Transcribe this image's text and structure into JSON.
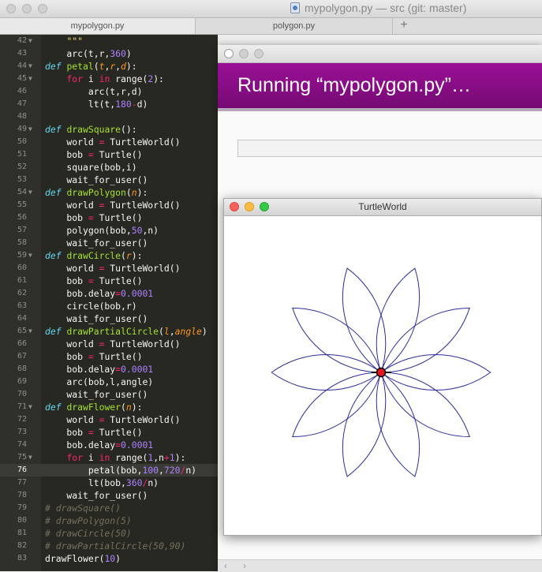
{
  "app": {
    "window_title": "mypolygon.py — src (git: master)"
  },
  "tabs": [
    {
      "label": "mypolygon.py",
      "active": true
    },
    {
      "label": "polygon.py",
      "active": false
    }
  ],
  "tab_add_label": "+",
  "editor": {
    "current_line": 76,
    "lines": [
      {
        "n": "42",
        "fold": true,
        "html": "    <span class=\"str\">\"\"\"</span>"
      },
      {
        "n": "43",
        "fold": false,
        "html": "    arc(t,r,<span class=\"num\">360</span>)"
      },
      {
        "n": "44",
        "fold": true,
        "html": "<span class=\"kwdef\">def</span> <span class=\"fn\">petal</span>(<span class=\"arg\">t</span>,<span class=\"arg\">r</span>,<span class=\"arg\">d</span>):"
      },
      {
        "n": "45",
        "fold": true,
        "html": "    <span class=\"op\">for</span> i <span class=\"op\">in</span> range(<span class=\"num\">2</span>):"
      },
      {
        "n": "46",
        "fold": false,
        "html": "        arc(t,r,d)"
      },
      {
        "n": "47",
        "fold": false,
        "html": "        lt(t,<span class=\"num\">180</span><span class=\"op\">-</span>d)"
      },
      {
        "n": "48",
        "fold": false,
        "html": ""
      },
      {
        "n": "49",
        "fold": true,
        "html": "<span class=\"kwdef\">def</span> <span class=\"fn\">drawSquare</span>():"
      },
      {
        "n": "50",
        "fold": false,
        "html": "    world <span class=\"op\">=</span> TurtleWorld()"
      },
      {
        "n": "51",
        "fold": false,
        "html": "    bob <span class=\"op\">=</span> Turtle()"
      },
      {
        "n": "52",
        "fold": false,
        "html": "    square(bob,i)"
      },
      {
        "n": "53",
        "fold": false,
        "html": "    wait_for_user()"
      },
      {
        "n": "54",
        "fold": true,
        "html": "<span class=\"kwdef\">def</span> <span class=\"fn\">drawPolygon</span>(<span class=\"arg\">n</span>):"
      },
      {
        "n": "55",
        "fold": false,
        "html": "    world <span class=\"op\">=</span> TurtleWorld()"
      },
      {
        "n": "56",
        "fold": false,
        "html": "    bob <span class=\"op\">=</span> Turtle()"
      },
      {
        "n": "57",
        "fold": false,
        "html": "    polygon(bob,<span class=\"num\">50</span>,n)"
      },
      {
        "n": "58",
        "fold": false,
        "html": "    wait_for_user()"
      },
      {
        "n": "59",
        "fold": true,
        "html": "<span class=\"kwdef\">def</span> <span class=\"fn\">drawCircle</span>(<span class=\"arg\">r</span>):"
      },
      {
        "n": "60",
        "fold": false,
        "html": "    world <span class=\"op\">=</span> TurtleWorld()"
      },
      {
        "n": "61",
        "fold": false,
        "html": "    bob <span class=\"op\">=</span> Turtle()"
      },
      {
        "n": "62",
        "fold": false,
        "html": "    bob.delay<span class=\"op\">=</span><span class=\"num\">0.0001</span>"
      },
      {
        "n": "63",
        "fold": false,
        "html": "    circle(bob,r)"
      },
      {
        "n": "64",
        "fold": false,
        "html": "    wait_for_user()"
      },
      {
        "n": "65",
        "fold": true,
        "html": "<span class=\"kwdef\">def</span> <span class=\"fn\">drawPartialCircle</span>(<span class=\"arg\">l</span>,<span class=\"arg\">angle</span>)"
      },
      {
        "n": "66",
        "fold": false,
        "html": "    world <span class=\"op\">=</span> TurtleWorld()"
      },
      {
        "n": "67",
        "fold": false,
        "html": "    bob <span class=\"op\">=</span> Turtle()"
      },
      {
        "n": "68",
        "fold": false,
        "html": "    bob.delay<span class=\"op\">=</span><span class=\"num\">0.0001</span>"
      },
      {
        "n": "69",
        "fold": false,
        "html": "    arc(bob,l,angle)"
      },
      {
        "n": "70",
        "fold": false,
        "html": "    wait_for_user()"
      },
      {
        "n": "71",
        "fold": true,
        "html": "<span class=\"kwdef\">def</span> <span class=\"fn\">drawFlower</span>(<span class=\"arg\">n</span>):"
      },
      {
        "n": "72",
        "fold": false,
        "html": "    world <span class=\"op\">=</span> TurtleWorld()"
      },
      {
        "n": "73",
        "fold": false,
        "html": "    bob <span class=\"op\">=</span> Turtle()"
      },
      {
        "n": "74",
        "fold": false,
        "html": "    bob.delay<span class=\"op\">=</span><span class=\"num\">0.0001</span>"
      },
      {
        "n": "75",
        "fold": true,
        "html": "    <span class=\"op\">for</span> i <span class=\"op\">in</span> range(<span class=\"num\">1</span>,n<span class=\"op\">+</span><span class=\"num\">1</span>):"
      },
      {
        "n": "76",
        "fold": false,
        "html": "        petal(bob,<span class=\"num\">100</span>,<span class=\"num\">720</span><span class=\"op\">/</span>n)"
      },
      {
        "n": "77",
        "fold": false,
        "html": "        lt(bob,<span class=\"num\">360</span><span class=\"op\">/</span>n)"
      },
      {
        "n": "78",
        "fold": false,
        "html": "    wait_for_user()"
      },
      {
        "n": "79",
        "fold": false,
        "html": "<span class=\"com\"># drawSquare()</span>"
      },
      {
        "n": "80",
        "fold": false,
        "html": "<span class=\"com\"># drawPolygon(5)</span>"
      },
      {
        "n": "81",
        "fold": false,
        "html": "<span class=\"com\"># drawCircle(50)</span>"
      },
      {
        "n": "82",
        "fold": false,
        "html": "<span class=\"com\"># drawPartialCircle(50,90)</span>"
      },
      {
        "n": "83",
        "fold": false,
        "html": "drawFlower(<span class=\"num\">10</span>)"
      }
    ]
  },
  "run_window": {
    "banner_text": "Running “mypolygon.py”…",
    "nav_back": "‹",
    "nav_forward": "›"
  },
  "turtle_window": {
    "title": "TurtleWorld",
    "flower": {
      "petals": 10,
      "radius": 100,
      "petal_angle": 72,
      "line_color": "#2c2c9c"
    },
    "turtle_color": "#e8141e"
  },
  "colors": {
    "editor_bg": "#272822",
    "banner": "#8a0e87"
  }
}
